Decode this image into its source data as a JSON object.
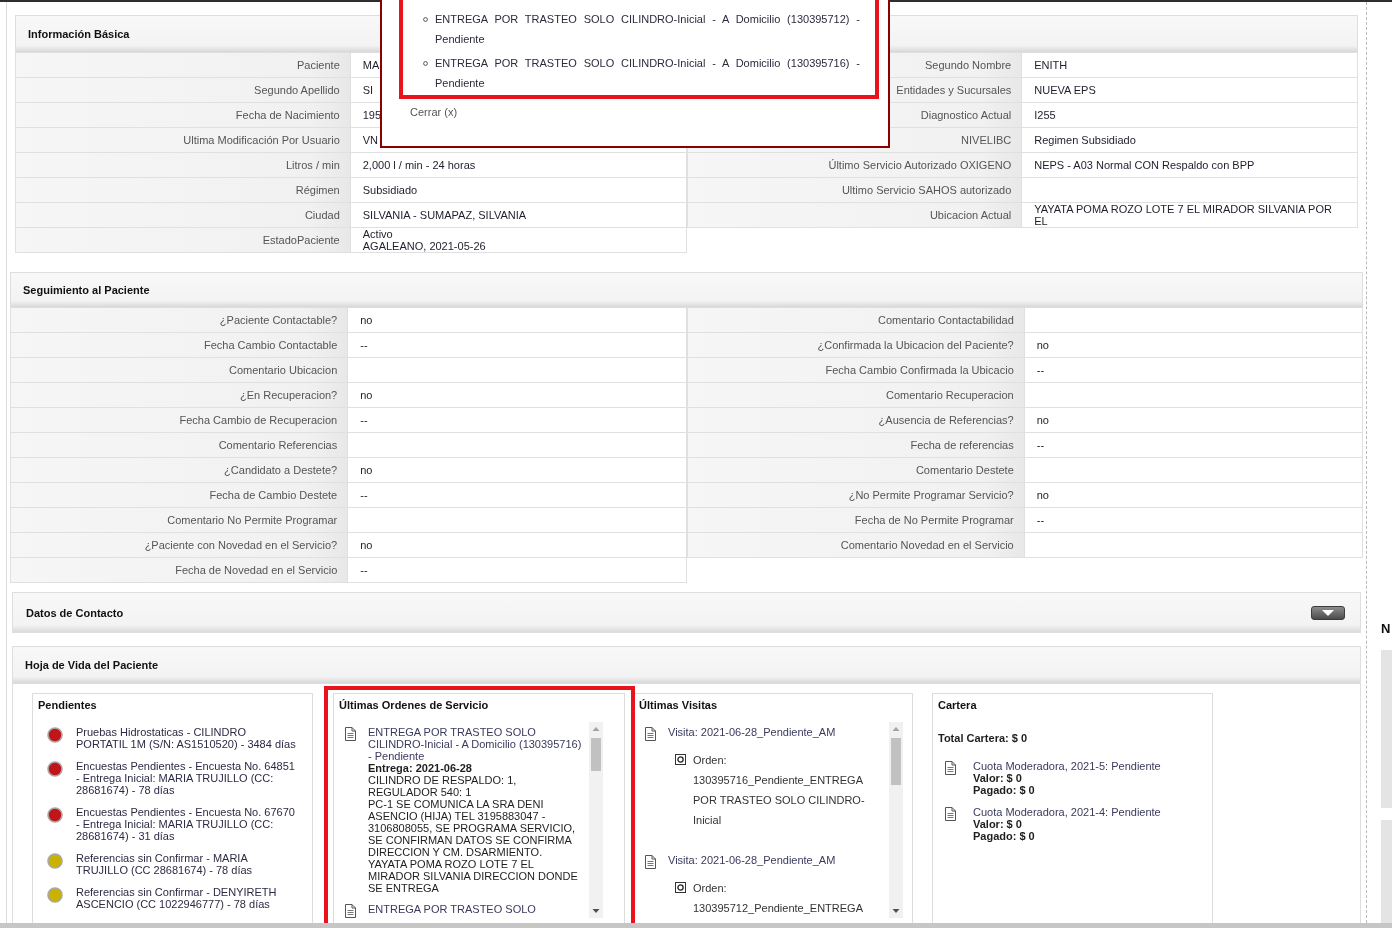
{
  "popup": {
    "highlighted": true,
    "items": [
      {
        "text": "ENTREGA POR TRASTEO SOLO CILINDRO-Inicial - A Domicilio (130395712) - Pendiente"
      },
      {
        "text": "ENTREGA POR TRASTEO SOLO CILINDRO-Inicial - A Domicilio (130395716) - Pendiente"
      }
    ],
    "close_link": "Cerrar (x)"
  },
  "basic_info": {
    "title": "Información Básica",
    "left_rows": [
      {
        "label": "Paciente",
        "value": "MA"
      },
      {
        "label": "Segundo Apellido",
        "value": "SI"
      },
      {
        "label": "Fecha de Nacimiento",
        "value": "195"
      },
      {
        "label": "Ultima Modificación Por Usuario",
        "value": "VN"
      },
      {
        "label": "Litros / min",
        "value": "2,000 l / min - 24 horas"
      },
      {
        "label": "Régimen",
        "value": "Subsidiado"
      },
      {
        "label": "Ciudad",
        "value": "SILVANIA - SUMAPAZ, SILVANIA"
      },
      {
        "label": "EstadoPaciente",
        "lines": [
          "Activo",
          "AGALEANO, 2021-05-26"
        ]
      }
    ],
    "right_rows": [
      {
        "label": "Segundo Nombre",
        "value": "ENITH"
      },
      {
        "label": "Entidades y Sucursales",
        "value": "NUEVA EPS"
      },
      {
        "label": "Diagnostico Actual",
        "value": "I255"
      },
      {
        "label": "NIVELIBC",
        "value": "Regimen Subsidiado"
      },
      {
        "label": "Último Servicio Autorizado OXIGENO",
        "value": "NEPS - A03 Normal CON Respaldo con BPP"
      },
      {
        "label": "Ultimo Servicio SAHOS autorizado"
      },
      {
        "label": "Ubicacion Actual",
        "value": "YAYATA POMA ROZO LOTE 7 EL MIRADOR SILVANIA POR EL"
      }
    ]
  },
  "follow_up": {
    "title": "Seguimiento al Paciente",
    "left_rows": [
      {
        "label": "¿Paciente Contactable?",
        "value": "no"
      },
      {
        "label": "Fecha Cambio Contactable",
        "value": "--"
      },
      {
        "label": "Comentario Ubicacion"
      },
      {
        "label": "¿En Recuperacion?",
        "value": "no"
      },
      {
        "label": "Fecha Cambio de Recuperacion",
        "value": "--"
      },
      {
        "label": "Comentario Referencias"
      },
      {
        "label": "¿Candidato a Destete?",
        "value": "no"
      },
      {
        "label": "Fecha de Cambio Destete",
        "value": "--"
      },
      {
        "label": "Comentario No Permite Programar"
      },
      {
        "label": "¿Paciente con Novedad en el Servicio?",
        "value": "no"
      },
      {
        "label": "Fecha de Novedad en el Servicio",
        "value": "--"
      }
    ],
    "right_rows": [
      {
        "label": "Comentario Contactabilidad"
      },
      {
        "label": "¿Confirmada la Ubicacion del Paciente?",
        "value": "no"
      },
      {
        "label": "Fecha Cambio Confirmada la Ubicacio",
        "value": "--"
      },
      {
        "label": "Comentario Recuperacion"
      },
      {
        "label": "¿Ausencia de Referencias?",
        "value": "no"
      },
      {
        "label": "Fecha de referencias",
        "value": "--"
      },
      {
        "label": "Comentario Destete"
      },
      {
        "label": "¿No Permite Programar Servicio?",
        "value": "no"
      },
      {
        "label": "Fecha de No Permite Programar",
        "value": "--"
      },
      {
        "label": "Comentario Novedad en el Servicio"
      }
    ]
  },
  "contact": {
    "title": "Datos de Contacto",
    "expanded": false
  },
  "history": {
    "title": "Hoja de Vida del Paciente",
    "pending": {
      "title": "Pendientes",
      "items": [
        {
          "text": "Pruebas Hidrostaticas - CILINDRO PORTATIL 1M (S/N: AS1510520) - 3484 días",
          "color": "#c0151b"
        },
        {
          "text": "Encuestas Pendientes - Encuesta No. 64851 - Entrega Inicial: MARIA TRUJILLO (CC: 28681674) - 78 días",
          "color": "#c0151b"
        },
        {
          "text": "Encuestas Pendientes - Encuesta No. 67670 - Entrega Inicial: MARIA TRUJILLO (CC: 28681674) - 31 días",
          "color": "#c0151b"
        },
        {
          "text": "Referencias sin Confirmar - MARIA TRUJILLO (CC 28681674) - 78 días",
          "color": "#c9b300"
        },
        {
          "text": "Referencias sin Confirmar - DENYIRETH ASCENCIO (CC 1022946777) - 78 días",
          "color": "#c9b300"
        }
      ]
    },
    "orders": {
      "title": "Últimas Ordenes de Servicio",
      "highlighted": true,
      "items": [
        {
          "title": "ENTREGA POR TRASTEO SOLO CILINDRO-Inicial - A Domicilio (130395716) - Pendiente",
          "delivery": "Entrega: 2021-06-28",
          "details": "CILINDRO DE RESPALDO: 1, REGULADOR 540: 1",
          "note": "PC-1 SE COMUNICA LA SRA DENI ASENCIO (HIJA) TEL 3195883047 - 3106808055, SE PROGRAMA SERVICIO, SE CONFIRMAN DATOS SE CONFIRMA DIRECCION Y CM. DSARMIENTO. YAYATA POMA ROZO LOTE 7 EL MIRADOR SILVANIA DIRECCION DONDE SE ENTREGA"
        },
        {
          "title": "ENTREGA POR TRASTEO SOLO"
        }
      ]
    },
    "visits": {
      "title": "Últimas Visitas",
      "items": [
        {
          "title": "Visita: 2021-06-28_Pendiente_AM",
          "order": "Orden: 130395716_Pendiente_ENTREGA POR TRASTEO SOLO CILINDRO-Inicial"
        },
        {
          "title": "Visita: 2021-06-28_Pendiente_AM",
          "order": "Orden: 130395712_Pendiente_ENTREGA"
        }
      ]
    },
    "portfolio": {
      "title": "Cartera",
      "total": "Total Cartera: $ 0",
      "items": [
        {
          "title": "Cuota Moderadora, 2021-5: Pendiente",
          "lines": [
            "Valor: $ 0",
            "Pagado: $ 0"
          ]
        },
        {
          "title": "Cuota Moderadora, 2021-4: Pendiente",
          "lines": [
            "Valor: $ 0",
            "Pagado: $ 0"
          ]
        }
      ]
    }
  },
  "sidebar": {
    "heading": "N"
  }
}
